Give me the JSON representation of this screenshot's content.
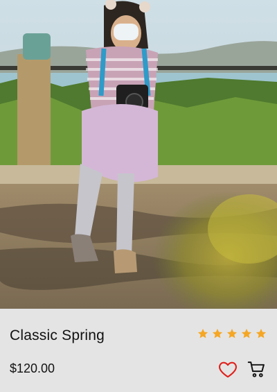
{
  "product": {
    "title": "Classic Spring",
    "price": "$120.00",
    "rating": 5,
    "rating_max": 5,
    "image_subject": "girl-with-camera-photo"
  },
  "colors": {
    "star": "#F5A623",
    "heart": "#E0201B",
    "cart": "#111111",
    "panel": "#E4E4E4"
  },
  "icons": {
    "favorite": "heart-outline-icon",
    "cart": "shopping-cart-icon",
    "star": "star-icon"
  }
}
